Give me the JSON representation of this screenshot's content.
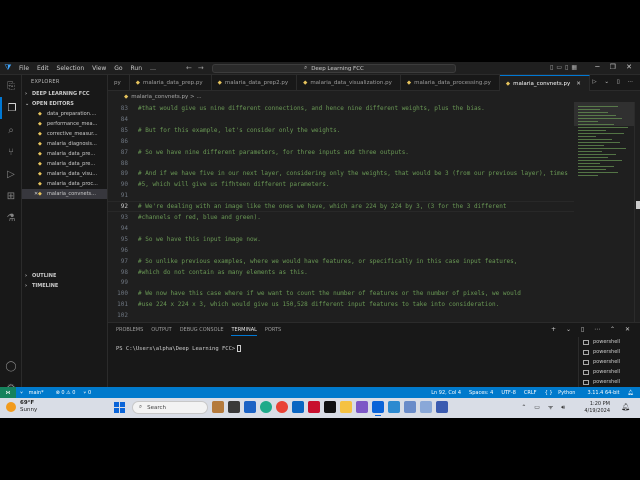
{
  "titlebar": {
    "menu": [
      "File",
      "Edit",
      "Selection",
      "View",
      "Go",
      "Run",
      "…"
    ],
    "command_center": "Deep Learning FCC"
  },
  "sidebar": {
    "header": "EXPLORER",
    "root": "DEEP LEARNING FCC",
    "open_editors": "OPEN EDITORS",
    "items": [
      {
        "label": "data_preparation...."
      },
      {
        "label": "performance_mea..."
      },
      {
        "label": "corrective_measur..."
      },
      {
        "label": "malaria_diagnosis..."
      },
      {
        "label": "malaria_data_pre..."
      },
      {
        "label": "malaria_data_pre..."
      },
      {
        "label": "malaria_data_visu..."
      },
      {
        "label": "malaria_data_proc..."
      },
      {
        "label": "malaria_convnets..."
      }
    ],
    "outline": "OUTLINE",
    "timeline": "TIMELINE"
  },
  "tabs": [
    {
      "label": "py"
    },
    {
      "label": "malaria_data_prep.py"
    },
    {
      "label": "malaria_data_prep2.py"
    },
    {
      "label": "malaria_data_visualization.py"
    },
    {
      "label": "malaria_data_processing.py"
    },
    {
      "label": "malaria_convnets.py"
    }
  ],
  "breadcrumb": "malaria_convnets.py > ...",
  "editor": {
    "lines": [
      {
        "n": "83",
        "text": "#that would give us nine different connections, and hence nine different weights, plus the bias."
      },
      {
        "n": "84",
        "text": ""
      },
      {
        "n": "85",
        "text": "# But for this example, let's consider only the weights."
      },
      {
        "n": "86",
        "text": ""
      },
      {
        "n": "87",
        "text": "# So we have nine different parameters, for three inputs and three outputs."
      },
      {
        "n": "88",
        "text": ""
      },
      {
        "n": "89",
        "text": "# And if we have five in our next layer, considering only the weights, that would be 3 (from our previous layer), times"
      },
      {
        "n": "90",
        "text": "#5, which will give us fifhteen different parameters."
      },
      {
        "n": "91",
        "text": ""
      },
      {
        "n": "92",
        "text": "# We're dealing with an image like the ones we have, which are 224 by 224 by 3, (3 for the 3 different"
      },
      {
        "n": "93",
        "text": "#channels of red, blue and green)."
      },
      {
        "n": "94",
        "text": ""
      },
      {
        "n": "95",
        "text": "# So we have this input image now."
      },
      {
        "n": "96",
        "text": ""
      },
      {
        "n": "97",
        "text": "# So unlike previous examples, where we would have features, or specifically in this case input features,"
      },
      {
        "n": "98",
        "text": "#which do not contain as many elements as this."
      },
      {
        "n": "99",
        "text": ""
      },
      {
        "n": "100",
        "text": "# We now have this case where if we want to count the number of features or the number of pixels, we would"
      },
      {
        "n": "101",
        "text": "#use 224 x 224 x 3, which would give us 150,528 different input features to take into consideration."
      },
      {
        "n": "102",
        "text": ""
      }
    ]
  },
  "panel": {
    "tabs": [
      "PROBLEMS",
      "OUTPUT",
      "DEBUG CONSOLE",
      "TERMINAL",
      "PORTS"
    ],
    "active_tab": "TERMINAL",
    "prompt": "PS C:\\Users\\alpha\\Deep Learning FCC>",
    "terminals": [
      "powershell",
      "powershell",
      "powershell",
      "powershell",
      "powershell",
      "powershell",
      "powershell",
      "powershell"
    ]
  },
  "statusbar": {
    "branch": "main*",
    "errors": "⊗ 0 ⚠ 0",
    "ports": "⑂ 0",
    "position": "Ln 92, Col 4",
    "spaces": "Spaces: 4",
    "encoding": "UTF-8",
    "eol": "CRLF",
    "language": "Python",
    "interpreter": "3.11.4 64-bit"
  },
  "taskbar": {
    "temp": "69°F",
    "weather": "Sunny",
    "search_placeholder": "Search",
    "time": "1:20 PM",
    "date": "4/19/2024"
  },
  "colors": {
    "comment": "#6a9955",
    "accent": "#007acc",
    "python_icon": "#e6c35c"
  }
}
